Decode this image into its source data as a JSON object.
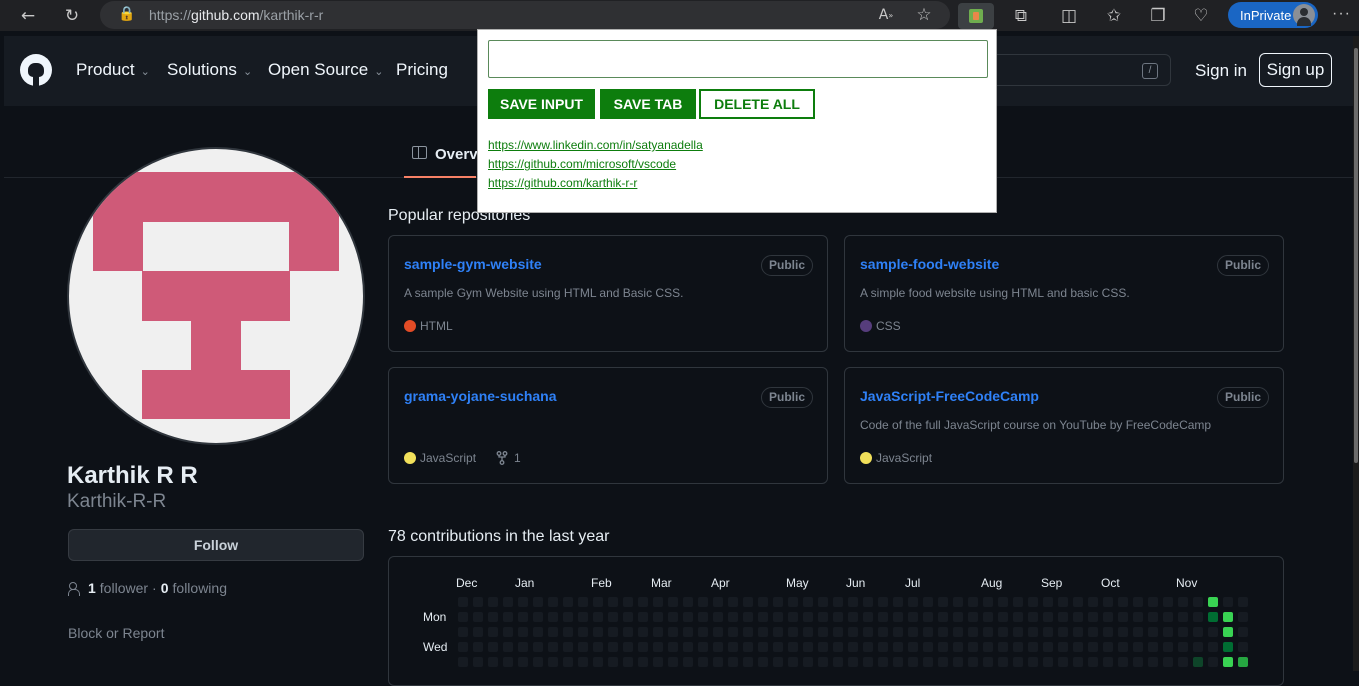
{
  "browser": {
    "url_prefix": "https://",
    "url_host": "github.com",
    "url_path": "/karthik-r-r",
    "inprivate_label": "InPrivate"
  },
  "header": {
    "nav": [
      "Product",
      "Solutions",
      "Open Source",
      "Pricing"
    ],
    "search_shortcut": "/",
    "signin": "Sign in",
    "signup": "Sign up"
  },
  "tabs": {
    "overview": "Overview"
  },
  "profile": {
    "name": "Karthik R R",
    "login": "Karthik-R-R",
    "follow": "Follow",
    "followers_count": "1",
    "followers_label": "follower",
    "separator": "·",
    "following_count": "0",
    "following_label": "following",
    "block_report": "Block or Report"
  },
  "popular": {
    "title": "Popular repositories",
    "repos": [
      {
        "name": "sample-gym-website",
        "badge": "Public",
        "desc": "A sample Gym Website using HTML and Basic CSS.",
        "lang": "HTML",
        "lang_color": "#e34c26",
        "forks": ""
      },
      {
        "name": "sample-food-website",
        "badge": "Public",
        "desc": "A simple food website using HTML and basic CSS.",
        "lang": "CSS",
        "lang_color": "#563d7c",
        "forks": ""
      },
      {
        "name": "grama-yojane-suchana",
        "badge": "Public",
        "desc": "",
        "lang": "JavaScript",
        "lang_color": "#f1e05a",
        "forks": "1"
      },
      {
        "name": "JavaScript-FreeCodeCamp",
        "badge": "Public",
        "desc": "Code of the full JavaScript course on YouTube by FreeCodeCamp",
        "lang": "JavaScript",
        "lang_color": "#f1e05a",
        "forks": ""
      }
    ]
  },
  "contributions": {
    "title": "78 contributions in the last year",
    "months": [
      "Dec",
      "Jan",
      "Feb",
      "Mar",
      "Apr",
      "May",
      "Jun",
      "Jul",
      "Aug",
      "Sep",
      "Oct",
      "Nov"
    ],
    "day_labels": [
      "Mon",
      "Wed"
    ],
    "colors": {
      "empty": "#161b22",
      "l1": "#0e4429",
      "l2": "#006d32",
      "l3": "#26a641",
      "l4": "#39d353"
    }
  },
  "popup": {
    "input_value": "",
    "save_input": "SAVE INPUT",
    "save_tab": "SAVE TAB",
    "delete_all": "DELETE ALL",
    "links": [
      "https://www.linkedin.com/in/satyanadella",
      "https://github.com/microsoft/vscode",
      "https://github.com/karthik-r-r"
    ]
  }
}
